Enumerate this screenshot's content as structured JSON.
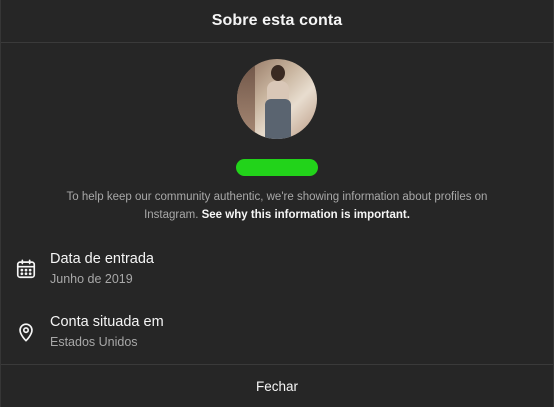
{
  "dialog": {
    "title": "Sobre esta conta",
    "avatar_icon": "profile-photo",
    "username_highlight_color": "#22d31a",
    "info": {
      "text": "To help keep our community authentic, we're showing information about profiles on Instagram. ",
      "link": "See why this information is important."
    },
    "rows": [
      {
        "icon": "calendar-icon",
        "title": "Data de entrada",
        "value": "Junho de 2019"
      },
      {
        "icon": "location-pin-icon",
        "title": "Conta situada em",
        "value": "Estados Unidos"
      }
    ],
    "close_label": "Fechar"
  }
}
